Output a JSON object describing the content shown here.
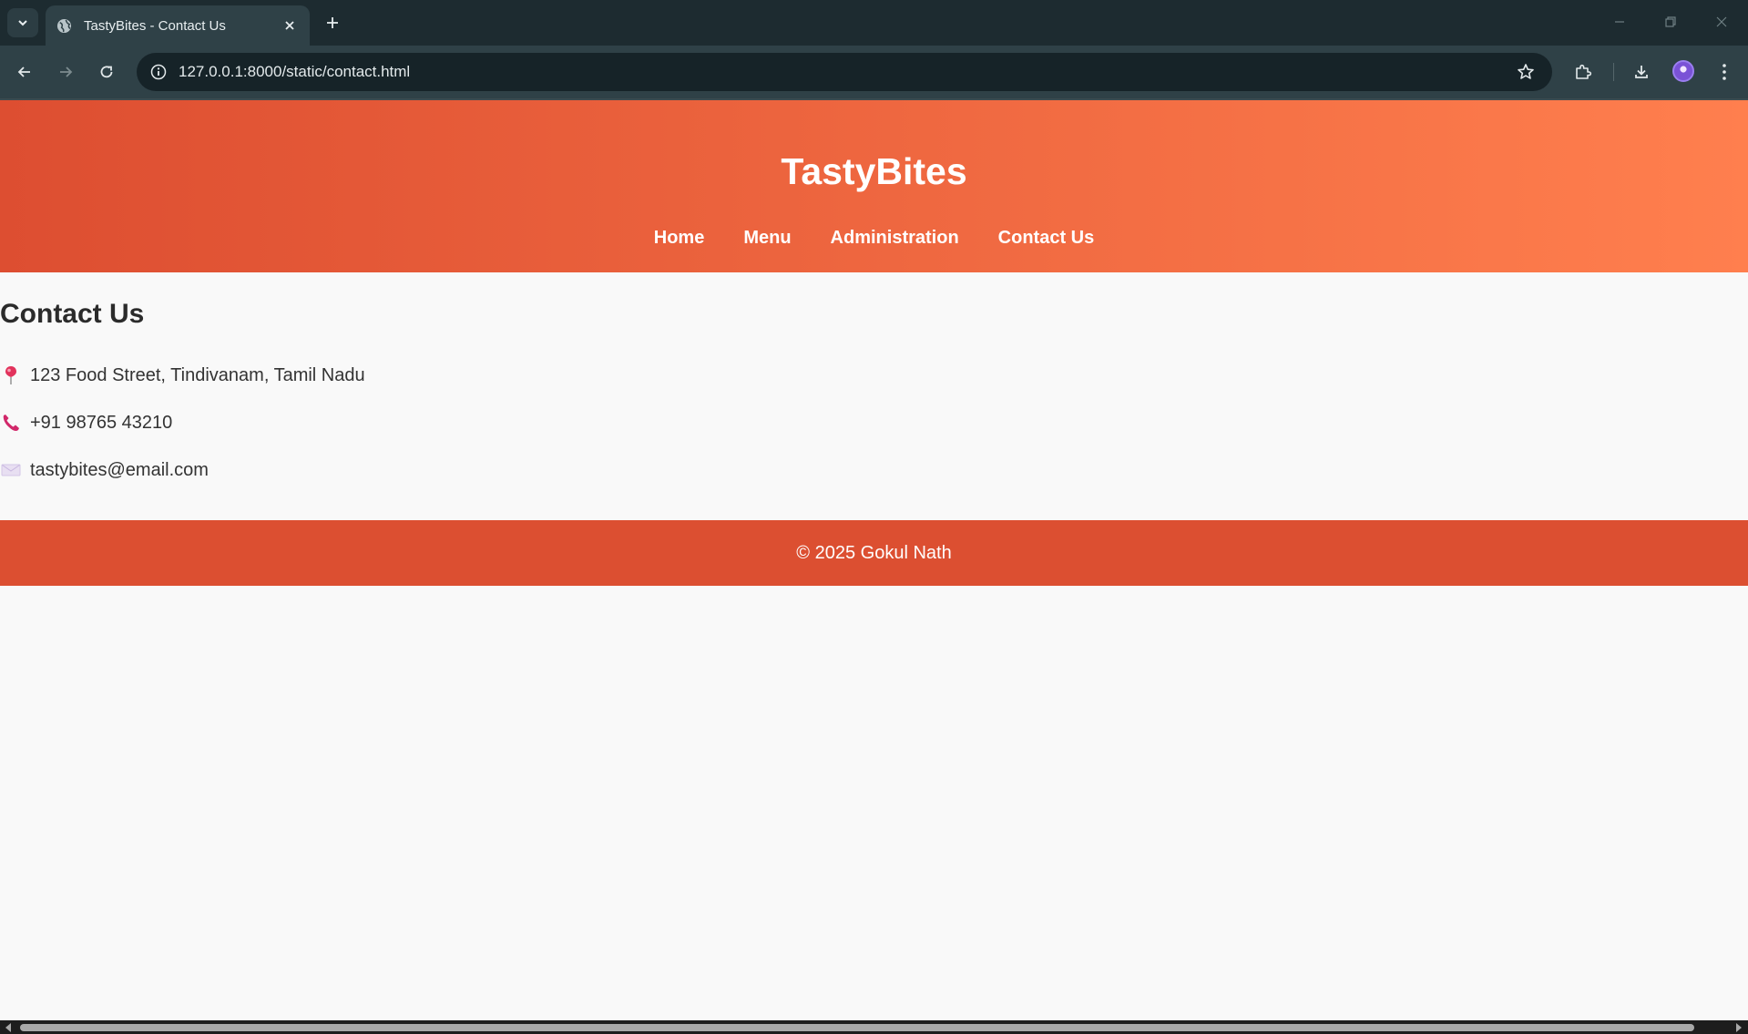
{
  "browser": {
    "tab_title": "TastyBites - Contact Us",
    "url": "127.0.0.1:8000/static/contact.html"
  },
  "site": {
    "brand": "TastyBites",
    "nav": [
      {
        "label": "Home"
      },
      {
        "label": "Menu"
      },
      {
        "label": "Administration"
      },
      {
        "label": "Contact Us"
      }
    ],
    "heading": "Contact Us",
    "contacts": {
      "address": {
        "icon": "pin-icon",
        "text": "123 Food Street, Tindivanam, Tamil Nadu"
      },
      "phone": {
        "icon": "phone-icon",
        "text": "+91 98765 43210"
      },
      "email": {
        "icon": "envelope-icon",
        "text": "tastybites@email.com"
      }
    },
    "footer": "© 2025 Gokul Nath",
    "colors": {
      "header_start": "#dd4e31",
      "header_end": "#ff7f4e",
      "footer": "#dc4f31"
    }
  }
}
